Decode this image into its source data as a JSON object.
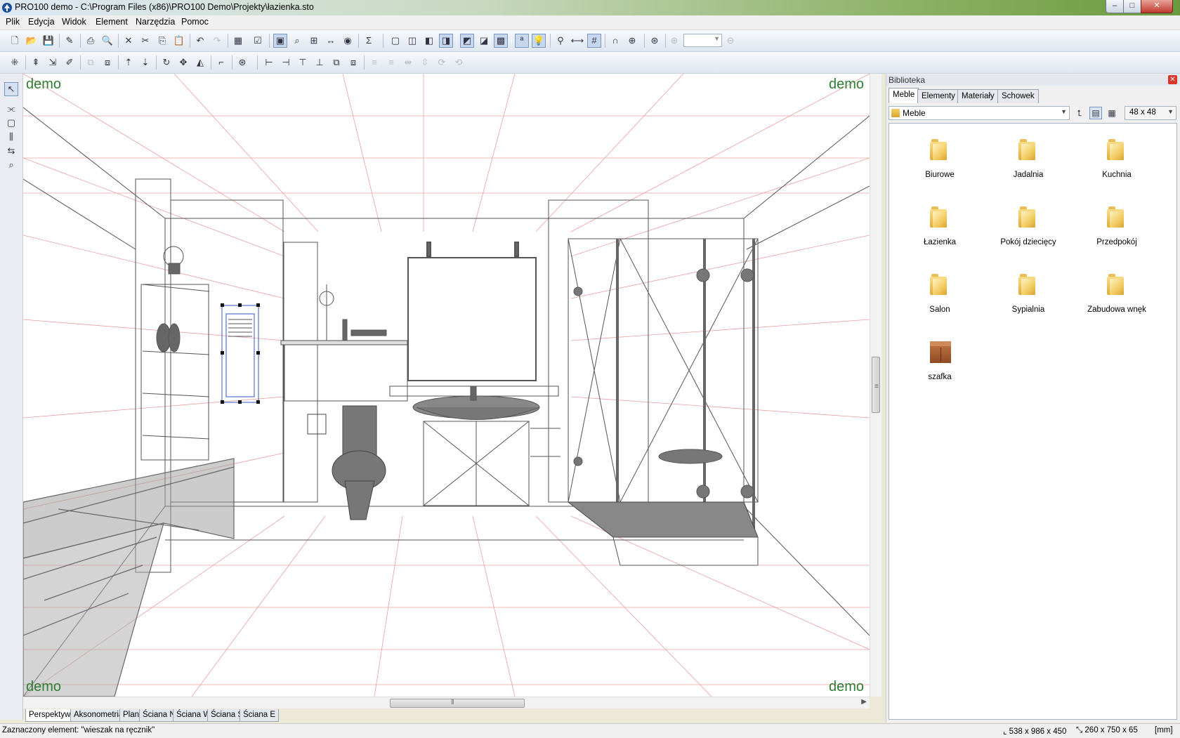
{
  "window": {
    "title": "PRO100 demo - C:\\Program Files (x86)\\PRO100 Demo\\Projekty\\łazienka.sto",
    "minimize_glyph": "–",
    "maximize_glyph": "□",
    "close_glyph": "✕"
  },
  "menu": [
    "Plik",
    "Edycja",
    "Widok",
    "Element",
    "Narzędzia",
    "Pomoc"
  ],
  "viewport": {
    "watermark": "demo"
  },
  "view_tabs": [
    "Perspektywa",
    "Aksonometria",
    "Plan",
    "Ściana N",
    "Ściana W",
    "Ściana S",
    "Ściana E"
  ],
  "status": {
    "selected": "Zaznaczony element: \"wieszak na ręcznik\"",
    "dims1": "538 x 986 x 450",
    "dims2": "260 x 750 x 65",
    "units": "[mm]"
  },
  "library": {
    "title": "Biblioteka",
    "tabs": [
      "Meble",
      "Elementy",
      "Materiały",
      "Schowek"
    ],
    "active_tab": "Meble",
    "folder": "Meble",
    "icon_size": "48 x  48",
    "items": [
      {
        "label": "Biurowe",
        "icon": "folder-icon"
      },
      {
        "label": "Jadalnia",
        "icon": "folder-icon"
      },
      {
        "label": "Kuchnia",
        "icon": "folder-icon"
      },
      {
        "label": "Łazienka",
        "icon": "folder-icon"
      },
      {
        "label": "Pokój dziecięcy",
        "icon": "folder-icon"
      },
      {
        "label": "Przedpokój",
        "icon": "folder-icon"
      },
      {
        "label": "Salon",
        "icon": "folder-icon"
      },
      {
        "label": "Sypialnia",
        "icon": "folder-icon"
      },
      {
        "label": "Zabudowa wnęk",
        "icon": "folder-icon"
      },
      {
        "label": "szafka",
        "icon": "cabinet-icon"
      }
    ]
  },
  "colors": {
    "watermark": "#2e7d32",
    "wire": "#555555",
    "grid": "#e8a0a0",
    "selection": "#3355cc"
  }
}
